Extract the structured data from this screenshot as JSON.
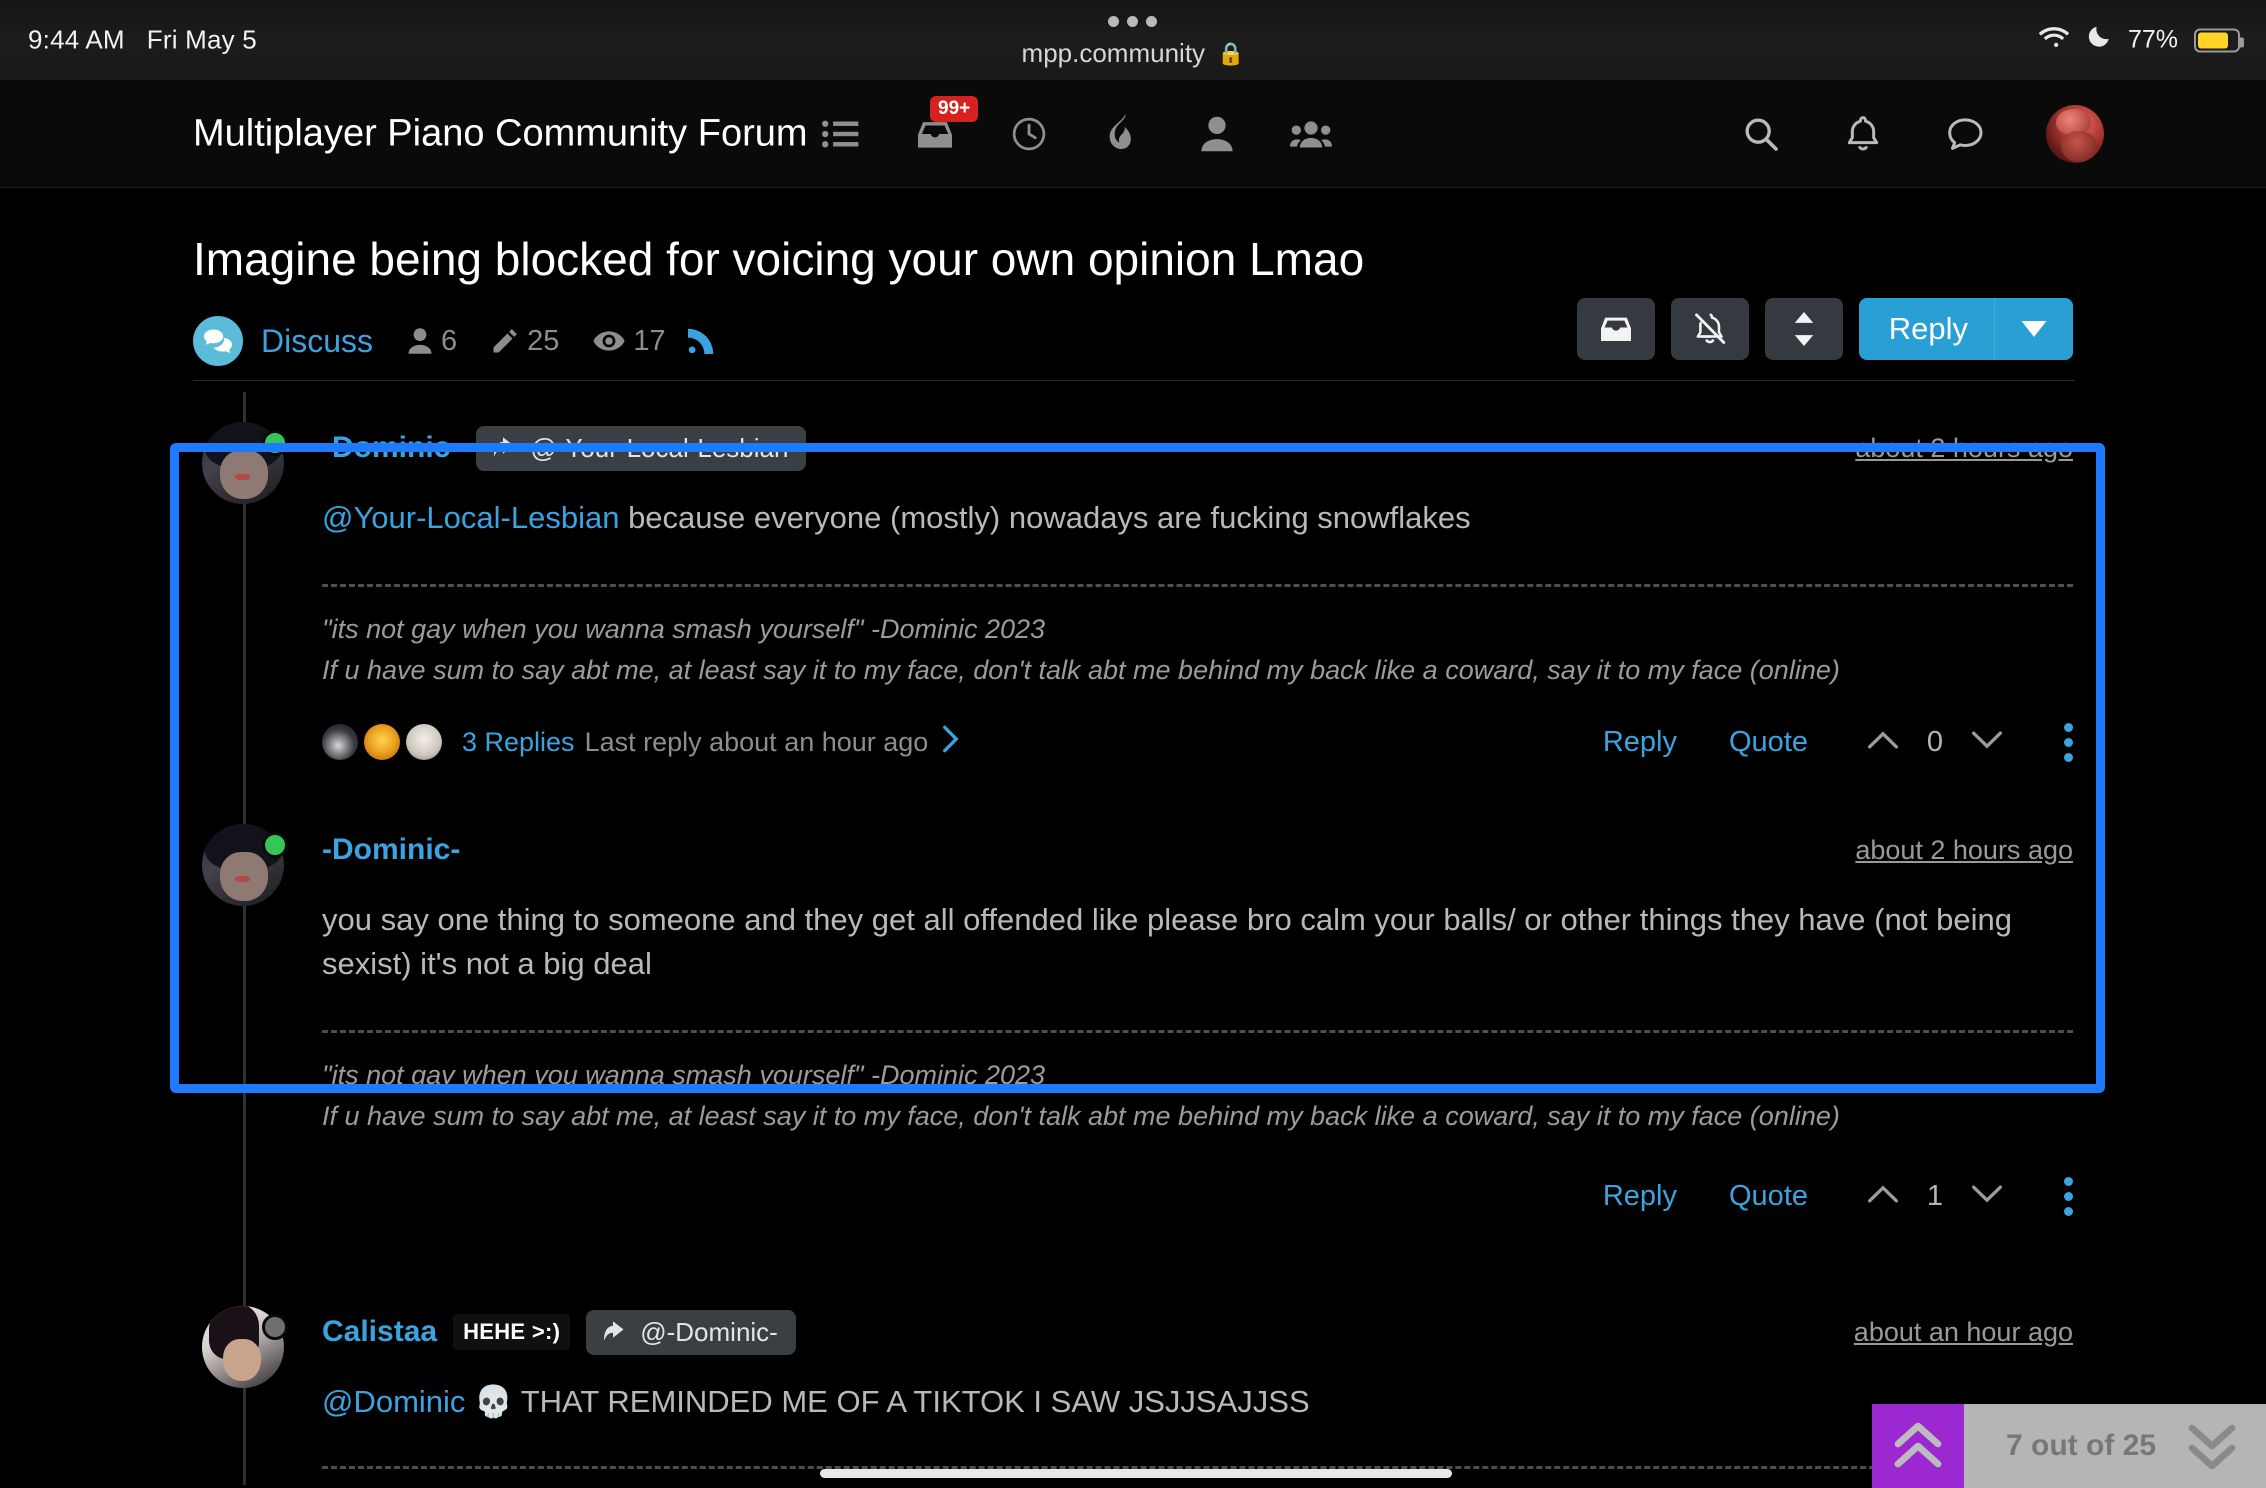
{
  "status_bar": {
    "time": "9:44 AM",
    "date": "Fri May 5",
    "battery_percent": "77%",
    "wifi_icon": "wifi-icon",
    "moon_icon": "moon-icon",
    "battery_icon": "battery-icon"
  },
  "browser": {
    "url": "mpp.community",
    "lock_icon": "lock-icon",
    "tab_dots_icon": "more-dots-icon"
  },
  "nav": {
    "brand": "Multiplayer Piano Community Forum",
    "mid_icons": [
      {
        "name": "categories-list-icon",
        "badge": ""
      },
      {
        "name": "unread-inbox-icon",
        "badge": "99+"
      },
      {
        "name": "recent-clock-icon",
        "badge": ""
      },
      {
        "name": "popular-flame-icon",
        "badge": ""
      },
      {
        "name": "user-icon",
        "badge": ""
      },
      {
        "name": "groups-icon",
        "badge": ""
      }
    ],
    "right_icons": [
      {
        "name": "search-icon"
      },
      {
        "name": "notifications-bell-icon"
      },
      {
        "name": "chat-bubble-icon"
      }
    ],
    "avatar_name": "user-avatar"
  },
  "thread": {
    "title": "Imagine being blocked for voicing your own opinion Lmao",
    "category": "Discuss",
    "category_icon": "discuss-bubbles-icon",
    "stats": {
      "users_icon": "user-icon",
      "users": "6",
      "posts_icon": "pencil-icon",
      "posts": "25",
      "views_icon": "eye-icon",
      "views": "17",
      "rss_icon": "rss-icon"
    },
    "actions": {
      "archive_icon": "inbox-archive-icon",
      "mute_icon": "bell-slash-icon",
      "sort_icon": "sort-updown-icon",
      "reply_label": "Reply",
      "reply_caret_icon": "chevron-down-icon"
    }
  },
  "posts": [
    {
      "username": "-Dominic-",
      "reply_chip": "@-Your-Local-Lesbian",
      "timestamp": "about 2 hours ago",
      "mention": "@Your-Local-Lesbian",
      "body": " because everyone (mostly) nowadays are fucking snowflakes",
      "signature_line_1": "\"its not gay when you wanna smash yourself\" -Dominic 2023",
      "signature_line_2": "If u have sum to say abt me, at least say it to my face, don't talk abt me behind my back like a coward, say it to my face (online)",
      "replies_link": "3 Replies",
      "replies_meta": "Last reply about an hour ago",
      "replies_chevron_icon": "chevron-right-icon",
      "reply_label": "Reply",
      "quote_label": "Quote",
      "upvote_icon": "chevron-up-icon",
      "downvote_icon": "chevron-down-icon",
      "vote_count": "0",
      "menu_icon": "kebab-menu-icon",
      "status": "online"
    },
    {
      "username": "-Dominic-",
      "timestamp": "about 2 hours ago",
      "body": "you say one thing to someone and they get all offended like please bro calm your balls/ or other things they have (not being sexist) it's not a big deal",
      "signature_line_1": "\"its not gay when you wanna smash yourself\" -Dominic 2023",
      "signature_line_2": "If u have sum to say abt me, at least say it to my face, don't talk abt me behind my back like a coward, say it to my face (online)",
      "reply_label": "Reply",
      "quote_label": "Quote",
      "upvote_icon": "chevron-up-icon",
      "downvote_icon": "chevron-down-icon",
      "vote_count": "1",
      "menu_icon": "kebab-menu-icon",
      "status": "online"
    },
    {
      "username": "Calistaa",
      "user_title": "HEHE >:)",
      "reply_chip": "@-Dominic-",
      "reply_chip_icon": "reply-arrow-icon",
      "timestamp": "about an hour ago",
      "mention": "@Dominic",
      "skull_icon": "skull-emoji",
      "body": " THAT REMINDED ME OF A TIKTOK I SAW JSJJSAJJSS",
      "status": "offline"
    }
  ],
  "bottom_nav": {
    "scroll_top_icon": "double-chevron-up-icon",
    "position_label": "7 out of 25",
    "scroll_bottom_icon": "double-chevron-down-icon",
    "accent_color": "#9b28d0"
  },
  "colors": {
    "accent_blue": "#3aa3e0",
    "reply_button": "#2a9fd6",
    "badge_red": "#d62121",
    "selection_blue": "#1e7bff",
    "online_green": "#35c65a",
    "category_chip": "#5bbcd9"
  }
}
